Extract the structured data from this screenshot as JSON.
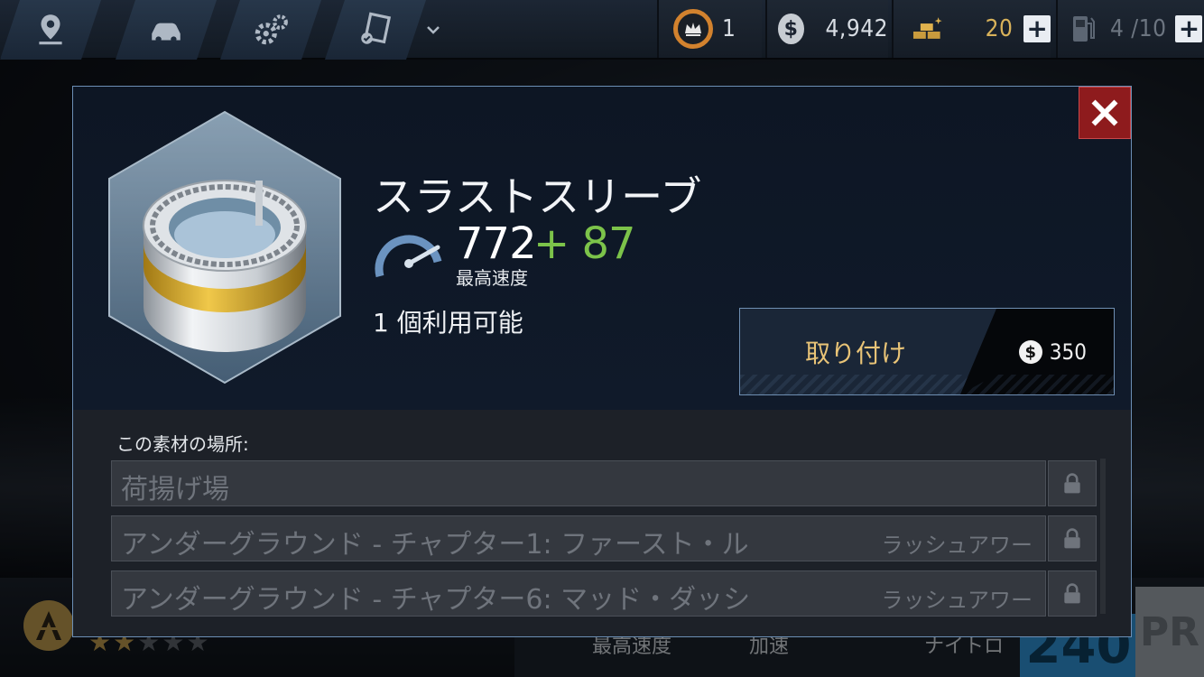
{
  "topbar": {
    "nav_tabs": [
      {
        "name": "map",
        "icon": "map-pin-icon"
      },
      {
        "name": "garage",
        "icon": "car-icon"
      },
      {
        "name": "upgrades",
        "icon": "gears-icon"
      },
      {
        "name": "tasks",
        "icon": "checklist-icon"
      }
    ],
    "dropdown_icon": "chevron-down-icon",
    "crown_count": "1",
    "cash": "4,942",
    "gold": "20",
    "fuel": "4 /10"
  },
  "modal": {
    "part_name": "スラストスリーブ",
    "stat_value": "772",
    "stat_bonus": "+ 87",
    "stat_label": "最高速度",
    "available": "1 個利用可能",
    "install_label": "取り付け",
    "install_cost": "350",
    "locations_heading": "この素材の場所:",
    "locations": [
      {
        "name": "荷揚げ場",
        "sub": ""
      },
      {
        "name": "アンダーグラウンド - チャプター1: ファースト・ル",
        "sub": "ラッシュアワー"
      },
      {
        "name": "アンダーグラウンド - チャプター6: マッド・ダッシ",
        "sub": "ラッシュアワー"
      }
    ]
  },
  "bottombar": {
    "stars_filled": 2,
    "stars_total": 5,
    "stat1": "最高速度",
    "stat2": "加速",
    "stat3": "ナイトロ",
    "pr_value": "240",
    "pr_label": "PR"
  },
  "colors": {
    "accent_gold": "#e9c477",
    "bonus_green": "#7cc34a",
    "close_red": "#8e1b1d",
    "modal_border": "#6c8fb5"
  }
}
